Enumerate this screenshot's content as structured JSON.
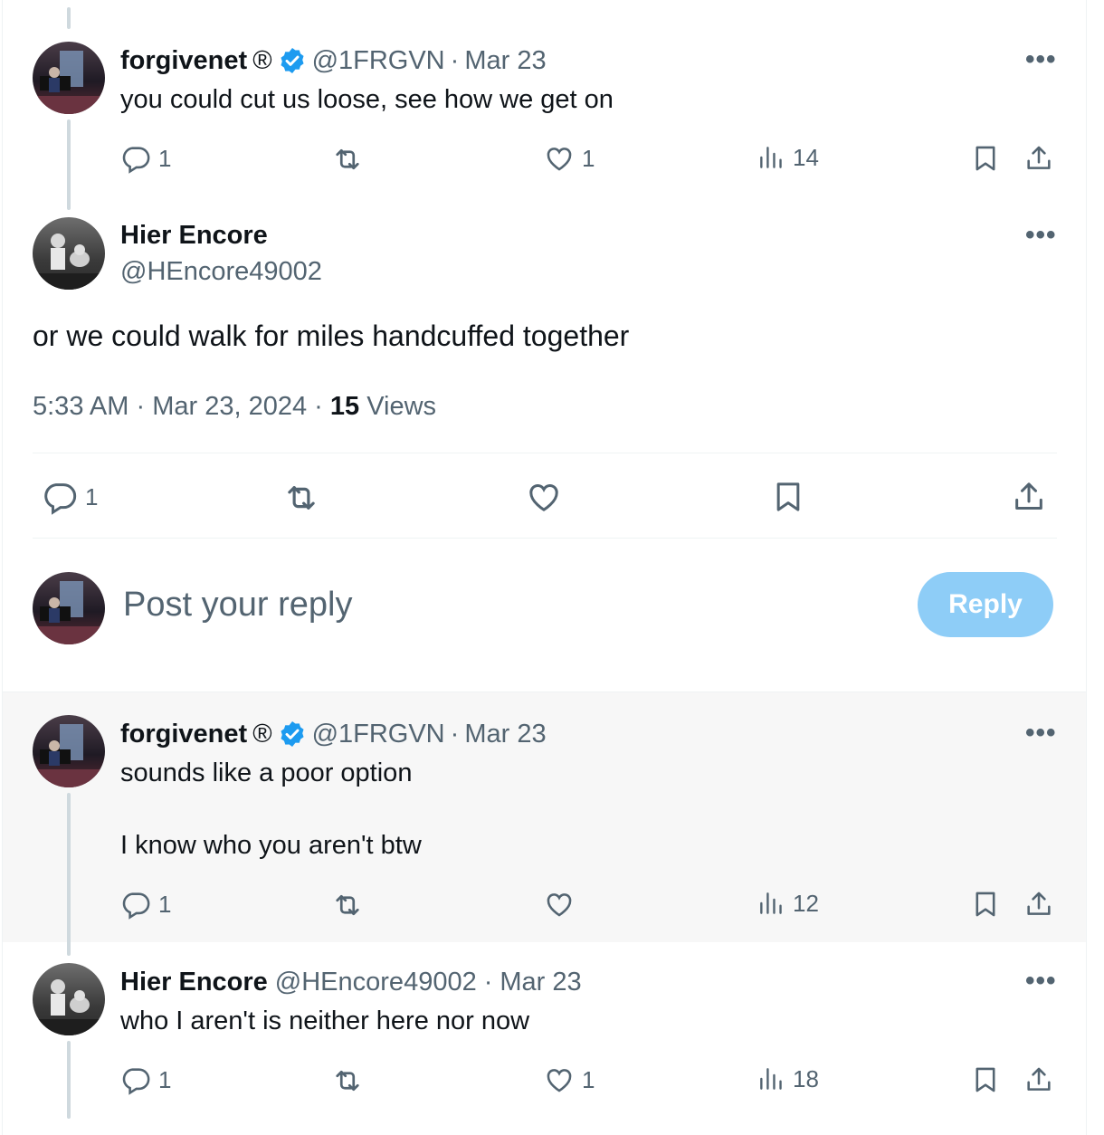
{
  "tweets": [
    {
      "name": "forgivenet",
      "registered_mark": "®",
      "verified": true,
      "handle": "@1FRGVN",
      "date": "Mar 23",
      "text": "you could cut us loose, see how we get on",
      "replies": "1",
      "retweets": "",
      "likes": "1",
      "views": "14"
    },
    {
      "name": "forgivenet",
      "registered_mark": "®",
      "verified": true,
      "handle": "@1FRGVN",
      "date": "Mar 23",
      "text_line1": "sounds like a poor option",
      "text_line2": "I know who you aren't btw",
      "replies": "1",
      "retweets": "",
      "likes": "",
      "views": "12"
    },
    {
      "name": "Hier Encore",
      "handle": "@HEncore49002",
      "date": "Mar 23",
      "text": "who I aren't is neither here nor now",
      "replies": "1",
      "retweets": "",
      "likes": "1",
      "views": "18"
    }
  ],
  "main_post": {
    "name": "Hier Encore",
    "handle": "@HEncore49002",
    "text": "or we could walk for miles handcuffed together",
    "time": "5:33 AM",
    "date": "Mar 23, 2024",
    "views_count": "15",
    "views_label": "Views",
    "replies": "1"
  },
  "compose": {
    "placeholder": "Post your reply",
    "button_label": "Reply"
  },
  "icons": {
    "more": "more-icon",
    "reply": "reply-icon",
    "retweet": "retweet-icon",
    "like": "heart-icon",
    "views": "analytics-icon",
    "bookmark": "bookmark-icon",
    "share": "share-icon",
    "verified": "verified-badge-icon"
  },
  "colors": {
    "accent": "#1d9bf0",
    "reply_button_disabled": "#8ecdf7",
    "secondary_text": "#536471",
    "thread_line": "#cfd9de",
    "highlight_bg": "#f7f7f7"
  },
  "separator": "·",
  "more_glyph": "•••"
}
